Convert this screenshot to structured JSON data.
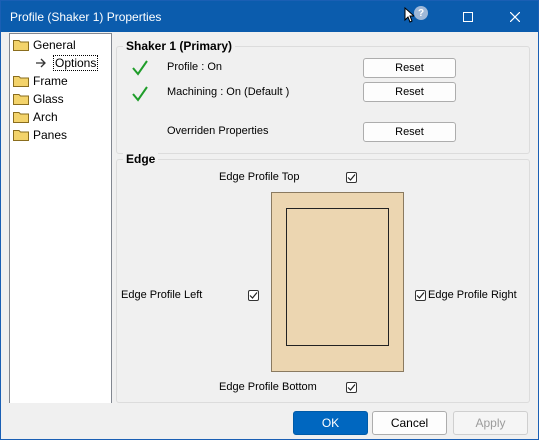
{
  "window": {
    "title": "Profile (Shaker 1) Properties"
  },
  "titlebar_buttons": {
    "help": "?",
    "maximize": "☐",
    "close": "✕"
  },
  "tree": {
    "items": [
      {
        "label": "General"
      },
      {
        "label": "Options"
      },
      {
        "label": "Frame"
      },
      {
        "label": "Glass"
      },
      {
        "label": "Arch"
      },
      {
        "label": "Panes"
      }
    ]
  },
  "shaker_group": {
    "title": "Shaker 1 (Primary)",
    "rows": [
      {
        "label": "Profile : On",
        "button": "Reset"
      },
      {
        "label": "Machining : On (Default )",
        "button": "Reset"
      },
      {
        "label": "Overriden Properties",
        "button": "Reset"
      }
    ]
  },
  "edge_group": {
    "title": "Edge",
    "top_label": "Edge Profile Top",
    "left_label": "Edge Profile Left",
    "right_label": "Edge Profile Right",
    "bottom_label": "Edge Profile Bottom"
  },
  "footer": {
    "ok": "OK",
    "cancel": "Cancel",
    "apply": "Apply"
  },
  "colors": {
    "titlebar": "#0b5cad",
    "ok_button": "#0067c0",
    "door_fill": "#ecd6b1",
    "check_green": "#1f9d2a"
  }
}
